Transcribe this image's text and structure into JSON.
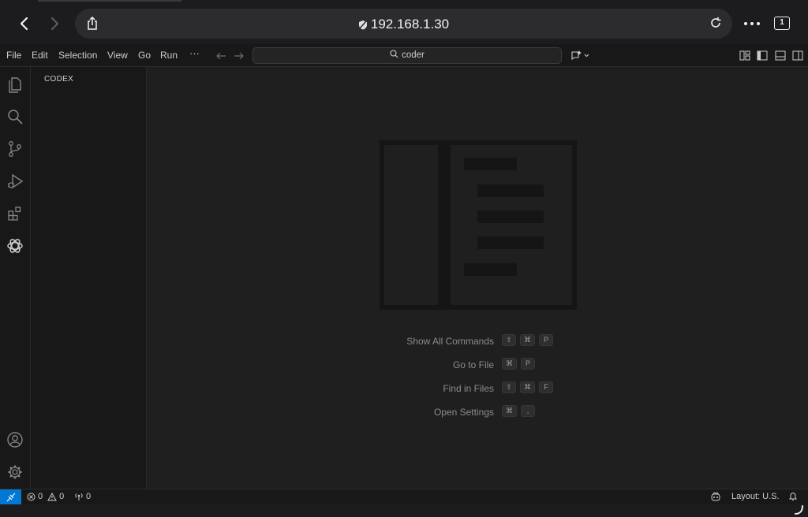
{
  "browser": {
    "url": "192.168.1.30",
    "tab_count": "1"
  },
  "menubar": {
    "items": [
      "File",
      "Edit",
      "Selection",
      "View",
      "Go",
      "Run"
    ],
    "more": "···",
    "command_center": "coder"
  },
  "sidebar": {
    "title": "CODEX"
  },
  "shortcuts": [
    {
      "label": "Show All Commands",
      "keys": [
        "⇧",
        "⌘",
        "P"
      ]
    },
    {
      "label": "Go to File",
      "keys": [
        "⌘",
        "P"
      ]
    },
    {
      "label": "Find in Files",
      "keys": [
        "⇧",
        "⌘",
        "F"
      ]
    },
    {
      "label": "Open Settings",
      "keys": [
        "⌘",
        ","
      ]
    }
  ],
  "statusbar": {
    "errors": "0",
    "warnings": "0",
    "ports": "0",
    "layout": "Layout: U.S."
  },
  "colors": {
    "accent": "#0078d4",
    "background": "#1f1f1f",
    "chrome": "#181818"
  }
}
